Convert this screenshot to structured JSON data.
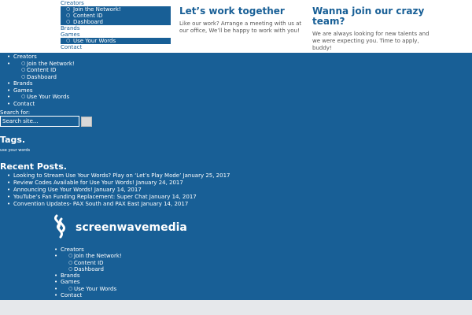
{
  "top_menu": {
    "creators": "Creators",
    "sub1": [
      "Join the Network!",
      "Content ID",
      "Dashboard"
    ],
    "brands": "Brands",
    "games": "Games",
    "sub2": [
      "Use Your Words"
    ],
    "contact": "Contact"
  },
  "work": {
    "title": "Let’s work together",
    "text": "Like our work? Arrange a meeting with us at our office, We’ll be happy to work with you!"
  },
  "join": {
    "title": "Wanna join our crazy team?",
    "text": "We are always looking for new talents and we were expecting you. Time to apply, buddy!"
  },
  "side_menu": {
    "creators": "Creators",
    "sub1": [
      "Join the Network!",
      "Content ID",
      "Dashboard"
    ],
    "brands": "Brands",
    "games": "Games",
    "sub2": [
      "Use Your Words"
    ],
    "contact": "Contact"
  },
  "search": {
    "label": "Search for:",
    "placeholder": "Search site..."
  },
  "tags": {
    "heading": "Tags.",
    "items": [
      "use your words"
    ]
  },
  "recent": {
    "heading": "Recent Posts.",
    "items": [
      "Looking to Stream Use Your Words? Play on ‘Let’s Play Mode’ January 25, 2017",
      "Review Codes Available for Use Your Words! January 24, 2017",
      "Announcing Use Your Words! January 14, 2017",
      "YouTube’s Fan Funding Replacement: Super Chat January 14, 2017",
      "Convention Updates- PAX South and PAX East January 14, 2017"
    ]
  },
  "logo": {
    "name": "screenwavemedia",
    "icon": "wave-logo-icon"
  },
  "footer_menu": {
    "creators": "Creators",
    "sub1": [
      "Join the Network!",
      "Content ID",
      "Dashboard"
    ],
    "brands": "Brands",
    "games": "Games",
    "sub2": [
      "Use Your Words"
    ],
    "contact": "Contact"
  },
  "colors": {
    "brand": "#185f96",
    "white": "#ffffff",
    "footer_bar": "#e6e8eb"
  }
}
